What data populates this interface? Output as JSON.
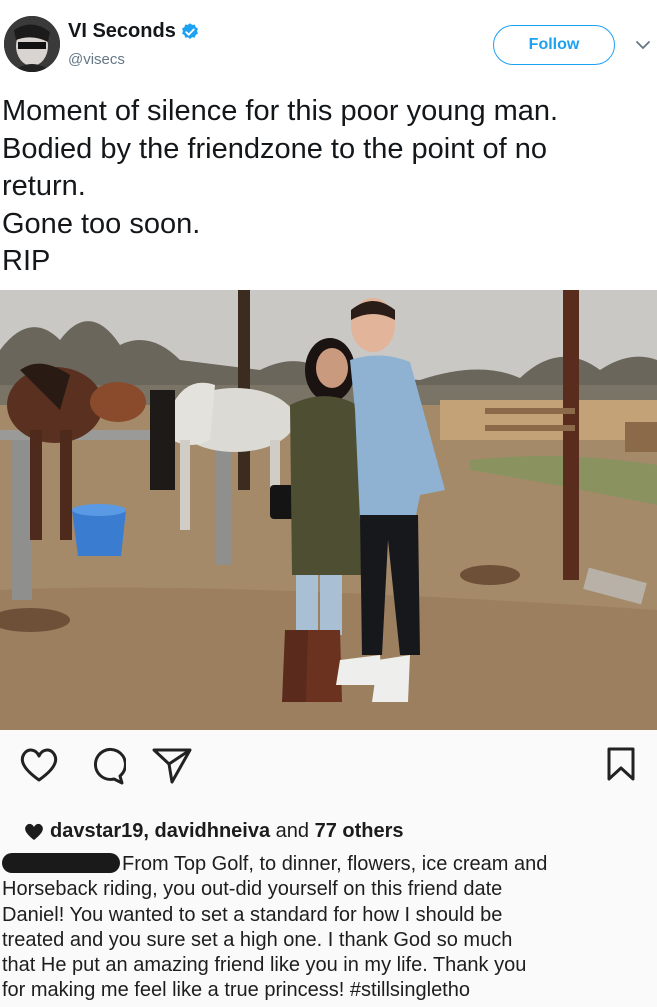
{
  "tweet": {
    "author": {
      "display_name": "VI Seconds",
      "handle": "@visecs",
      "verified": true
    },
    "follow_label": "Follow",
    "text_lines": [
      "Moment of silence for this poor young man.",
      "Bodied by the friendzone to the point of no",
      "return.",
      "Gone too soon.",
      "RIP"
    ]
  },
  "instagram_post": {
    "actions": [
      "heart-icon",
      "comment-icon",
      "share-icon",
      "bookmark-icon"
    ],
    "likes": {
      "users": "davstar19, davidhneiva",
      "connector": " and ",
      "others": "77 others"
    },
    "caption_lines": [
      "From Top Golf, to dinner, flowers, ice cream and",
      "Horseback riding, you out-did yourself on this friend date",
      "Daniel! You wanted to set a standard for how I should be",
      "treated and you sure set a high one. I thank God so much",
      "that He put an amazing friend like you in my life. Thank you",
      "for making me feel like a true princess! #stillsinglethо"
    ]
  },
  "colors": {
    "twitter_blue": "#1da1f2",
    "text_primary": "#14171a",
    "text_secondary": "#657786"
  }
}
